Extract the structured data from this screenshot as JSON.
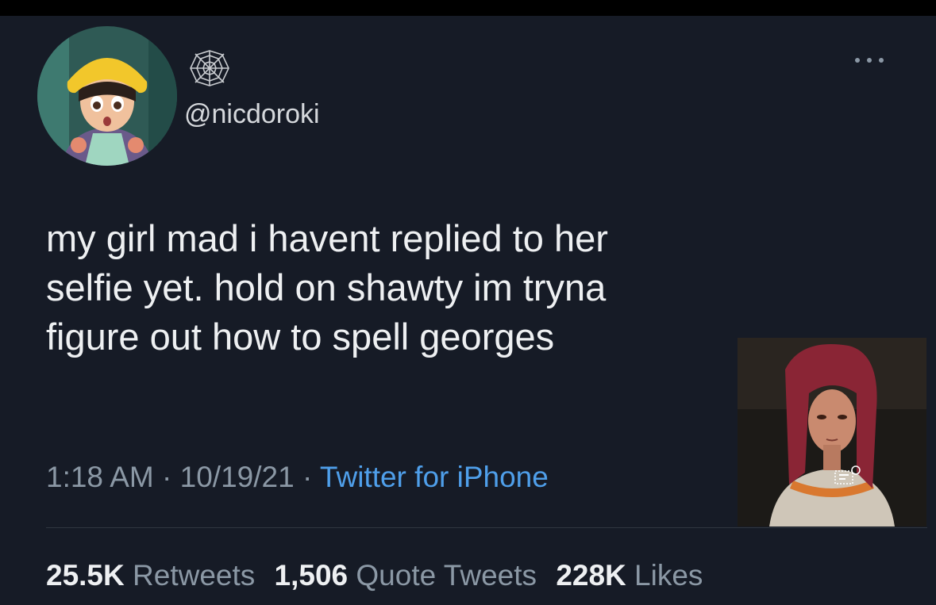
{
  "author": {
    "handle": "@nicdoroki",
    "avatar_icon": "animated-girl-yellow-hat-avatar",
    "badge_icon": "spider-web-icon"
  },
  "tweet": {
    "text_lines": [
      "my girl mad i havent replied to her",
      "selfie yet. hold on shawty im tryna",
      "figure out how to spell georges"
    ],
    "time": "1:18 AM",
    "date": "10/19/21",
    "separator": "·",
    "source": "Twitter for iPhone",
    "media_icon": "animated-red-haired-woman-thumbnail"
  },
  "stats": {
    "retweets_count": "25.5K",
    "retweets_label": "Retweets",
    "quotes_count": "1,506",
    "quotes_label": "Quote Tweets",
    "likes_count": "228K",
    "likes_label": "Likes"
  },
  "colors": {
    "background": "#161b26",
    "text": "#eef0f2",
    "muted": "#8b98a5",
    "link": "#4f9fea"
  }
}
